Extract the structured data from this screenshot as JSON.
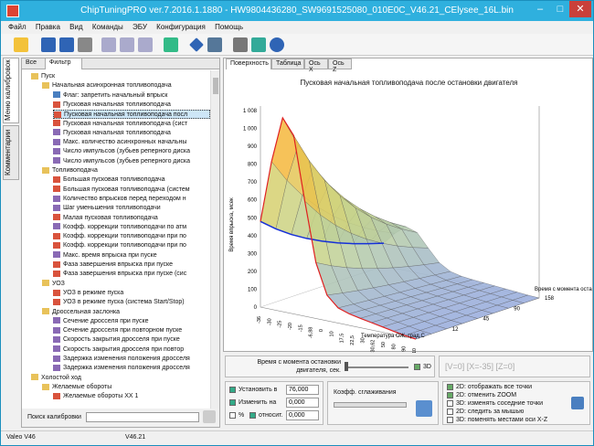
{
  "window": {
    "title": "ChipTuningPRO ver.7.2016.1.1880 - HW9804436280_SW9691525080_010E0C_V46.21_CElysee_16L.bin"
  },
  "menu": [
    "Файл",
    "Правка",
    "Вид",
    "Команды",
    "ЭБУ",
    "Конфигурация",
    "Помощь"
  ],
  "side_tabs": {
    "calib_menu": "Меню калибровок",
    "comments": "Комментарии"
  },
  "left_tabs": {
    "all": "Все",
    "filter": "Фильтр"
  },
  "tree": [
    {
      "label": "Пуск",
      "level": 0,
      "type": "folder"
    },
    {
      "label": "Начальная асинхронная топливоподача",
      "level": 1,
      "type": "folder"
    },
    {
      "label": "Флаг: запретить начальный впрыск",
      "level": 2,
      "type": "flag"
    },
    {
      "label": "Пусковая начальная топливоподача",
      "level": 2,
      "type": "map"
    },
    {
      "label": "Пусковая начальная топливоподача посл",
      "level": 2,
      "type": "map",
      "selected": true
    },
    {
      "label": "Пусковая начальная топливоподача (сист",
      "level": 2,
      "type": "map"
    },
    {
      "label": "Пусковая начальная топливоподача",
      "level": 2,
      "type": "curve"
    },
    {
      "label": "Макс. количество асинхронных начальны",
      "level": 2,
      "type": "curve"
    },
    {
      "label": "Число импульсов (зубьев реперного диска",
      "level": 2,
      "type": "curve"
    },
    {
      "label": "Число импульсов (зубьев реперного диска",
      "level": 2,
      "type": "curve"
    },
    {
      "label": "Топливоподача",
      "level": 1,
      "type": "folder"
    },
    {
      "label": "Большая пусковая топливоподача",
      "level": 2,
      "type": "map"
    },
    {
      "label": "Большая пусковая топливоподача (систем",
      "level": 2,
      "type": "map"
    },
    {
      "label": "Количество впрысков перед переходом н",
      "level": 2,
      "type": "curve"
    },
    {
      "label": "Шаг уменьшения топливоподачи",
      "level": 2,
      "type": "curve"
    },
    {
      "label": "Малая пусковая топливоподача",
      "level": 2,
      "type": "map"
    },
    {
      "label": "Коэфф. коррекции топливоподачи по атм",
      "level": 2,
      "type": "curve"
    },
    {
      "label": "Коэфф. коррекции топливоподачи при по",
      "level": 2,
      "type": "map"
    },
    {
      "label": "Коэфф. коррекции топливоподачи при по",
      "level": 2,
      "type": "map"
    },
    {
      "label": "Макс. время впрыска при пуске",
      "level": 2,
      "type": "curve"
    },
    {
      "label": "Фаза завершения впрыска при пуске",
      "level": 2,
      "type": "map"
    },
    {
      "label": "Фаза завершения впрыска при пуске (сис",
      "level": 2,
      "type": "map"
    },
    {
      "label": "УОЗ",
      "level": 1,
      "type": "folder"
    },
    {
      "label": "УОЗ в режиме пуска",
      "level": 2,
      "type": "map"
    },
    {
      "label": "УОЗ в режиме пуска (система Start/Stop)",
      "level": 2,
      "type": "map"
    },
    {
      "label": "Дроссельная заслонка",
      "level": 1,
      "type": "folder"
    },
    {
      "label": "Сечение дросселя при пуске",
      "level": 2,
      "type": "curve"
    },
    {
      "label": "Сечение дросселя при повторном пуске",
      "level": 2,
      "type": "curve"
    },
    {
      "label": "Скорость закрытия дросселя при пуске",
      "level": 2,
      "type": "curve"
    },
    {
      "label": "Скорость закрытия дросселя при повтор",
      "level": 2,
      "type": "curve"
    },
    {
      "label": "Задержка изменения положения дросселя",
      "level": 2,
      "type": "curve"
    },
    {
      "label": "Задержка изменения положения дросселя",
      "level": 2,
      "type": "curve"
    },
    {
      "label": "Холостой ход",
      "level": 0,
      "type": "folder"
    },
    {
      "label": "Желаемые обороты",
      "level": 1,
      "type": "folder"
    },
    {
      "label": "Желаемые обороты ХХ 1",
      "level": 2,
      "type": "map"
    }
  ],
  "search": {
    "label": "Поиск калибровки"
  },
  "right_tabs": [
    "Поверхность",
    "Таблица",
    "Ось X",
    "Ось Z"
  ],
  "chart_data": {
    "type": "surface3d",
    "title": "Пусковая начальная топливоподача после остановки двигателя",
    "xlabel": "Температура ОЖ, град.С",
    "ylabel": "Время впрыска, мсек",
    "zlabel": "Время с момента оста",
    "x_ticks": [
      "-36",
      "-30",
      "-25",
      "-20",
      "-15",
      "-6,88",
      "0",
      "10",
      "17,5",
      "22,5",
      "30",
      "30,62",
      "50",
      "80",
      "90",
      "110"
    ],
    "z_ticks": [
      "12",
      "45",
      "90",
      "158"
    ],
    "y_ticks": [
      "0",
      "100",
      "200",
      "300",
      "400",
      "500",
      "600",
      "700",
      "800",
      "900",
      "1 000",
      "1 008"
    ],
    "ylim": [
      0,
      1008
    ]
  },
  "controls": {
    "time_label": "Время с момента остановки двигателя, сек.",
    "check_3d": "3D",
    "coords_readout": "[V=0] [X=-35] [Z=0]",
    "set_label": "Установить в",
    "set_value": "76,000",
    "change_label": "Изменить на",
    "change_value": "0,000",
    "percent_label": "%",
    "rel_label": "относит.",
    "rel_value": "0,000",
    "smooth_label": "Коэфф. сглаживания",
    "options": [
      "2D: отображать все точки",
      "2D: отменить ZOOM",
      "3D: изменять соседние точки",
      "2D: следить за мышью",
      "3D: поменять местами оси X-Z"
    ]
  },
  "status": {
    "left": "Valeo V46",
    "right": "V46.21"
  },
  "colors": {
    "title_bg": "#2fb0de",
    "selected_row": "#cde6f7"
  }
}
